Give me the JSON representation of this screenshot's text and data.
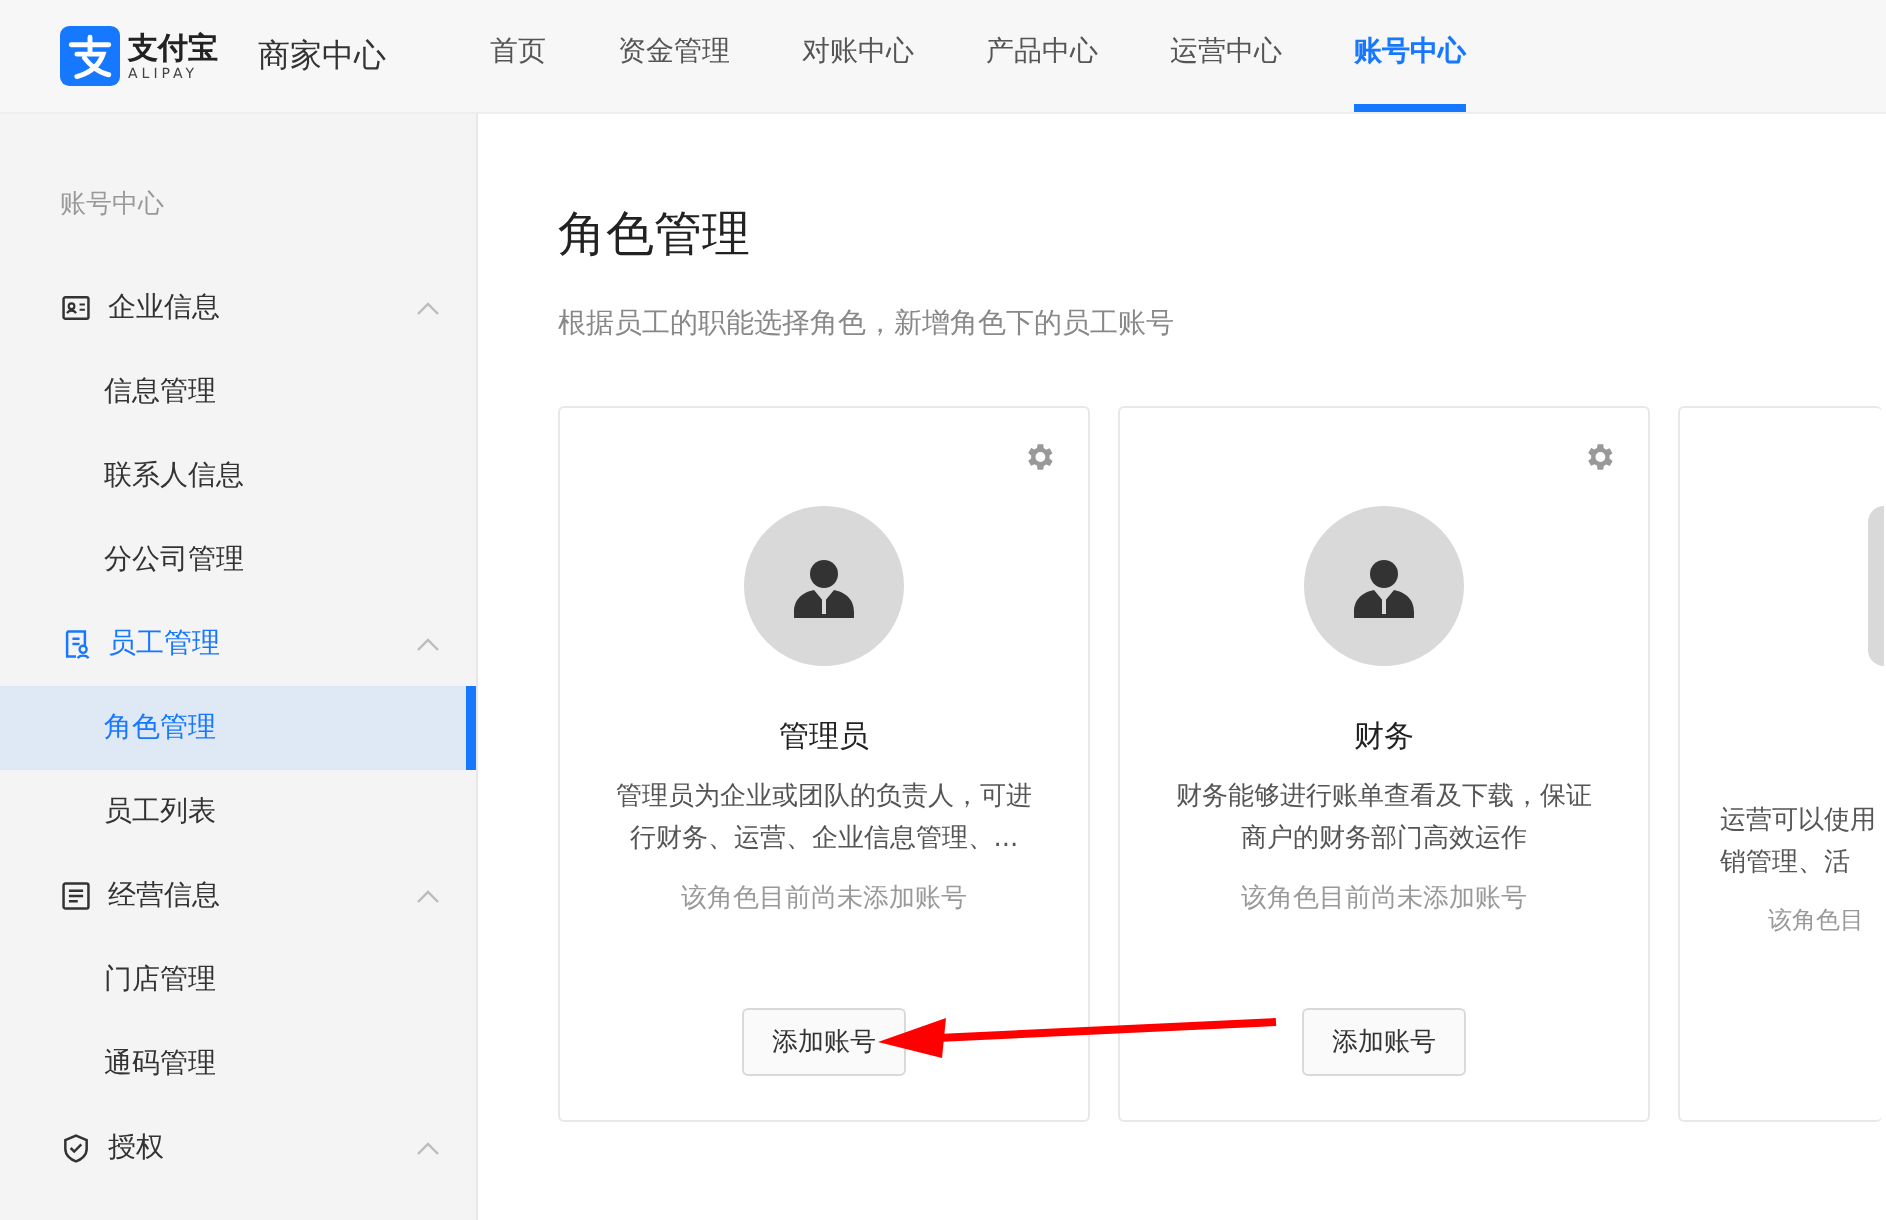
{
  "header": {
    "logo_text": "支付宝",
    "logo_subtext": "ALIPAY",
    "product": "商家中心",
    "nav": [
      {
        "label": "首页",
        "selected": false
      },
      {
        "label": "资金管理",
        "selected": false
      },
      {
        "label": "对账中心",
        "selected": false
      },
      {
        "label": "产品中心",
        "selected": false
      },
      {
        "label": "运营中心",
        "selected": false
      },
      {
        "label": "账号中心",
        "selected": true
      }
    ]
  },
  "sidebar": {
    "title": "账号中心",
    "groups": [
      {
        "label": "企业信息",
        "kind": "id-card",
        "expanded": true,
        "active": false,
        "items": [
          {
            "label": "信息管理",
            "selected": false
          },
          {
            "label": "联系人信息",
            "selected": false
          },
          {
            "label": "分公司管理",
            "selected": false
          }
        ]
      },
      {
        "label": "员工管理",
        "kind": "staff",
        "expanded": true,
        "active": true,
        "items": [
          {
            "label": "角色管理",
            "selected": true
          },
          {
            "label": "员工列表",
            "selected": false
          }
        ]
      },
      {
        "label": "经营信息",
        "kind": "document",
        "expanded": true,
        "active": false,
        "items": [
          {
            "label": "门店管理",
            "selected": false
          },
          {
            "label": "通码管理",
            "selected": false
          }
        ]
      },
      {
        "label": "授权",
        "kind": "shield",
        "expanded": true,
        "active": false
      }
    ]
  },
  "main": {
    "title": "角色管理",
    "subtitle": "根据员工的职能选择角色，新增角色下的员工账号",
    "cards": [
      {
        "kind": "full",
        "name": "管理员",
        "description_lines": [
          "管理员为企业或团队的负责人，可进",
          "行财务、运营、企业信息管理、..."
        ],
        "status": "该角色目前尚未添加账号",
        "button": "添加账号"
      },
      {
        "kind": "full",
        "name": "财务",
        "description_lines": [
          "财务能够进行账单查看及下载，保证",
          "商户的财务部门高效运作"
        ],
        "status": "该角色目前尚未添加账号",
        "button": "添加账号"
      },
      {
        "kind": "partial",
        "description_lines": [
          "运营可以使用",
          "销管理、活"
        ],
        "status": "该角色目"
      }
    ]
  }
}
